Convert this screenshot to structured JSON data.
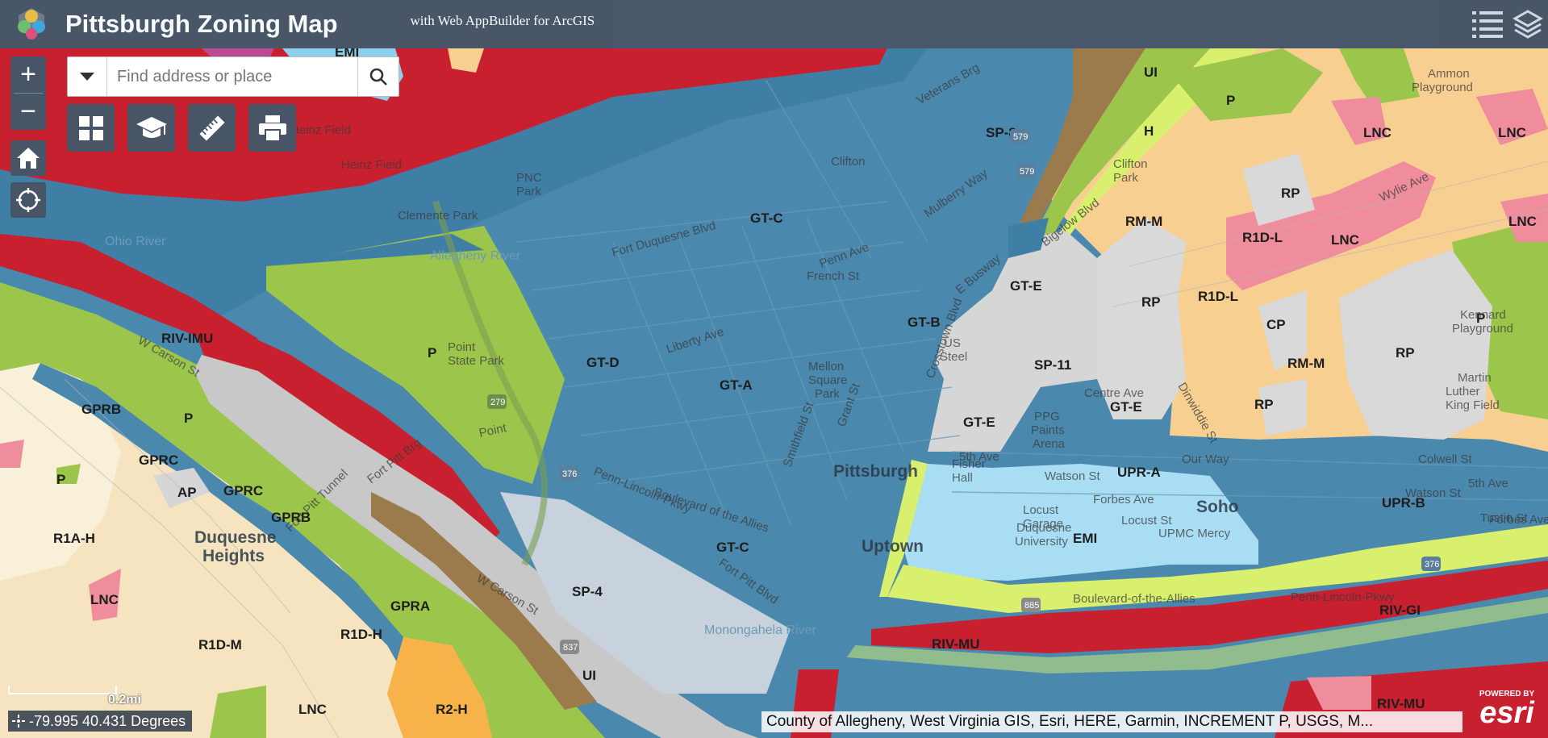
{
  "header": {
    "title": "Pittsburgh Zoning Map",
    "subtitle": "with Web AppBuilder for ArcGIS"
  },
  "search": {
    "placeholder": "Find address or place"
  },
  "scale": {
    "label": "0.2mi"
  },
  "coordinates": {
    "text": "-79.995 40.431 Degrees"
  },
  "attribution": {
    "text": "County of Allegheny, West Virginia GIS, Esri, HERE, Garmin, INCREMENT P, USGS, M..."
  },
  "esri_badge": {
    "powered": "POWERED BY",
    "name": "esri"
  },
  "colors": {
    "downtown_blue": "#4a88ad",
    "river_red": "#c8202f",
    "park_green": "#9cc54b",
    "residential_cream": "#f5e4bf",
    "mixed_orange": "#f7cf91",
    "institution_lightblue": "#a9ddf4",
    "special_gray": "#d6d6d6",
    "commercial_pink": "#ef8d9c",
    "header": "#485566"
  },
  "map": {
    "zone_labels": [
      "EMI",
      "UI",
      "P",
      "H",
      "LNC",
      "LNC",
      "LNC",
      "LNC",
      "SP-8",
      "GT-C",
      "RM-M",
      "RP",
      "R1D-L",
      "R1D-L",
      "RP",
      "CP",
      "P",
      "RP",
      "RP",
      "GT-E",
      "GT-B",
      "SP-11",
      "GT-E",
      "GT-E",
      "RM-M",
      "GT-D",
      "GT-A",
      "RIV-IMU",
      "P",
      "P",
      "GPRB",
      "GPRC",
      "GPRC",
      "AP",
      "GPRB",
      "R1A-H",
      "LNC",
      "R1D-M",
      "R1D-H",
      "GPRA",
      "SP-4",
      "UI",
      "GT-C",
      "UPR-A",
      "UPR-B",
      "EMI",
      "RIV-GI",
      "RIV-MU",
      "RIV-MU",
      "LNC",
      "R2-H"
    ],
    "place_labels": [
      "Pittsburgh",
      "Uptown",
      "Soho",
      "Duquesne Heights"
    ],
    "water_labels": [
      "Ohio River",
      "Allegheny River",
      "Monongahela River"
    ],
    "street_labels": [
      "Fort Duquesne Blvd",
      "Liberty Ave",
      "Penn Ave",
      "Fifth Ave",
      "Forbes Ave",
      "Boulevard of the Allies",
      "Penn-Lincoln-Pkwy",
      "Fort Pitt Blvd",
      "Grant St",
      "Smithfield St",
      "Wylie Ave",
      "Centre Ave",
      "W Carson St",
      "Bigelow Blvd",
      "Point State Park",
      "PPG Paints Arena",
      "Mellon Square Park",
      "Duquesne University",
      "UPMC Mercy",
      "Heinz Field",
      "Clemente Park",
      "PNC Park",
      "Crosstown Blvd",
      "Mulberry Way",
      "Fort Pitt Tunnel",
      "Fort Pitt Brg",
      "Veterans Brg",
      "Dinwiddie St",
      "Kennard Playground",
      "Ammon Playground",
      "Martin Luther King Field"
    ]
  }
}
